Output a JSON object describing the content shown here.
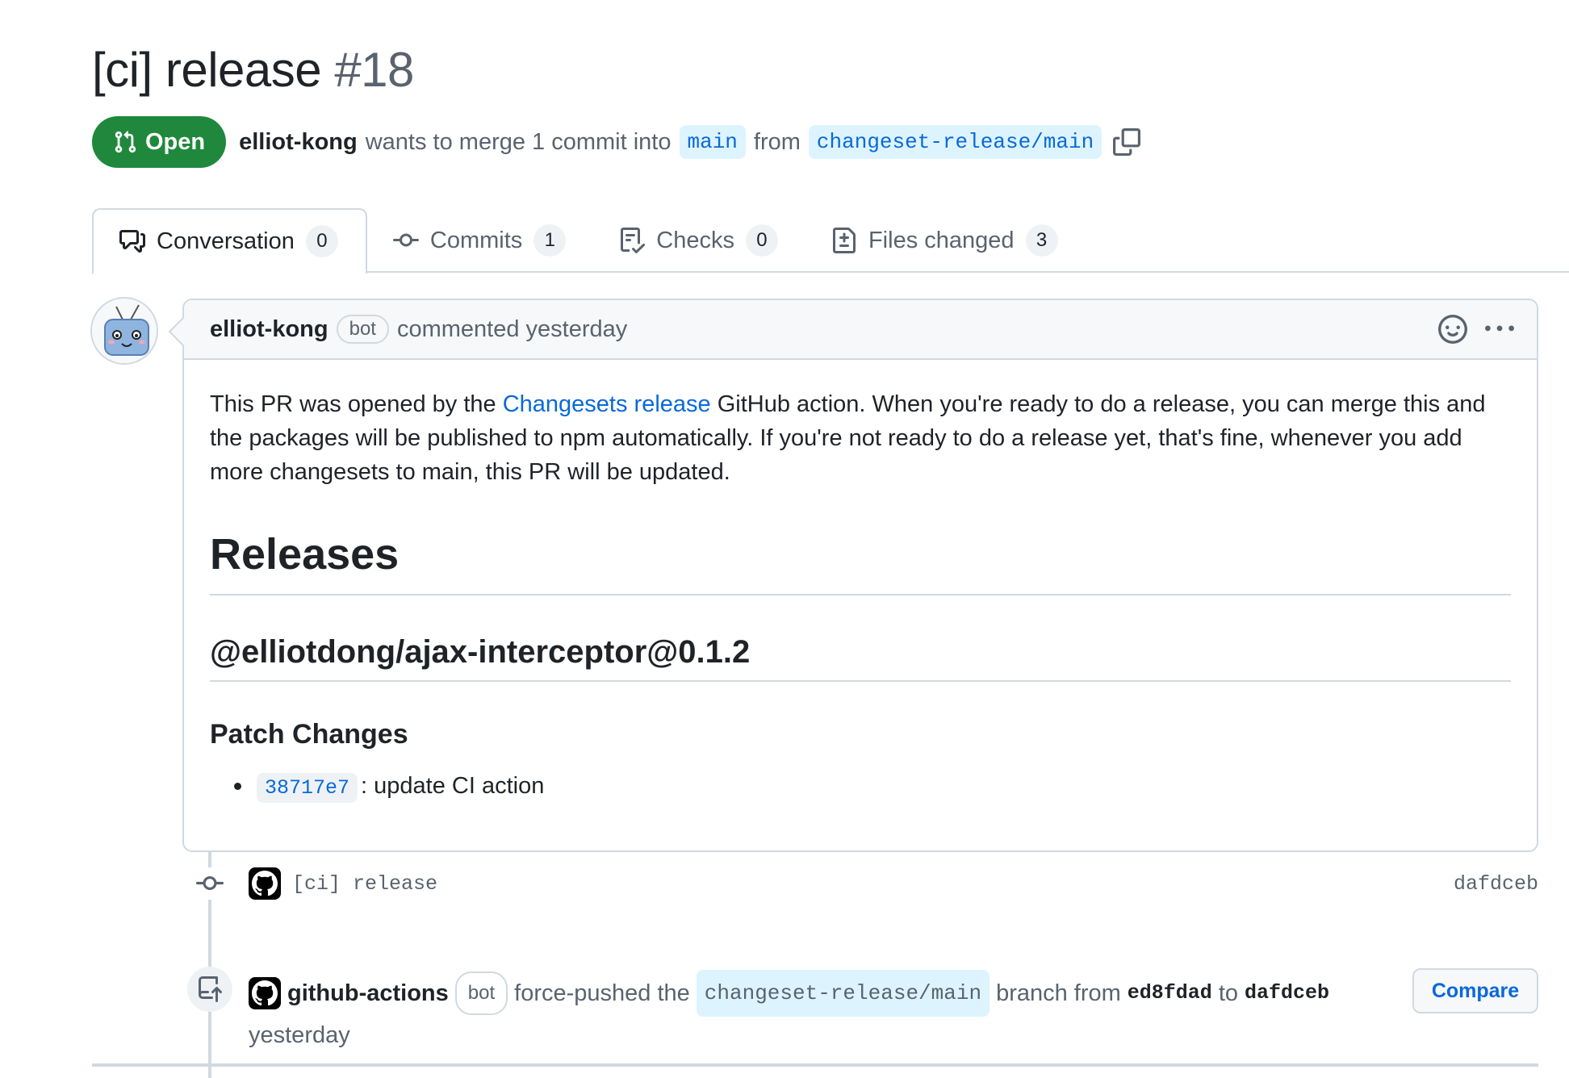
{
  "pr": {
    "title": "[ci] release",
    "number": "#18",
    "state": "Open",
    "author": "elliot-kong",
    "merge_text": "wants to merge 1 commit into",
    "base_branch": "main",
    "from_text": "from",
    "head_branch": "changeset-release/main"
  },
  "tabs": [
    {
      "label": "Conversation",
      "count": "0",
      "icon": "comment-discussion-icon"
    },
    {
      "label": "Commits",
      "count": "1",
      "icon": "git-commit-icon"
    },
    {
      "label": "Checks",
      "count": "0",
      "icon": "checklist-icon"
    },
    {
      "label": "Files changed",
      "count": "3",
      "icon": "file-diff-icon"
    }
  ],
  "comment": {
    "author": "elliot-kong",
    "badge": "bot",
    "meta": "commented yesterday",
    "intro_before_link": "This PR was opened by the",
    "link_text": "Changesets release",
    "intro_after_link": "GitHub action. When you're ready to do a release, you can merge this and the packages will be published to npm automatically. If you're not ready to do a release yet, that's fine, whenever you add more changesets to main, this PR will be updated.",
    "h1": "Releases",
    "h2": "@elliotdong/ajax-interceptor@0.1.2",
    "h3": "Patch Changes",
    "changes": [
      {
        "sha": "38717e7",
        "text": ": update CI action"
      }
    ]
  },
  "commit": {
    "message": "[ci] release",
    "sha": "dafdceb"
  },
  "push_event": {
    "author": "github-actions",
    "badge": "bot",
    "action_text": "force-pushed the",
    "branch": "changeset-release/main",
    "from_text": "branch from",
    "from_sha": "ed8fdad",
    "to_text": "to",
    "to_sha": "dafdceb",
    "time": "yesterday",
    "compare_label": "Compare"
  },
  "colors": {
    "open_green": "#1f883d",
    "link_blue": "#0969da",
    "branch_bg": "#ddf4ff",
    "border": "#d1d9e0"
  }
}
